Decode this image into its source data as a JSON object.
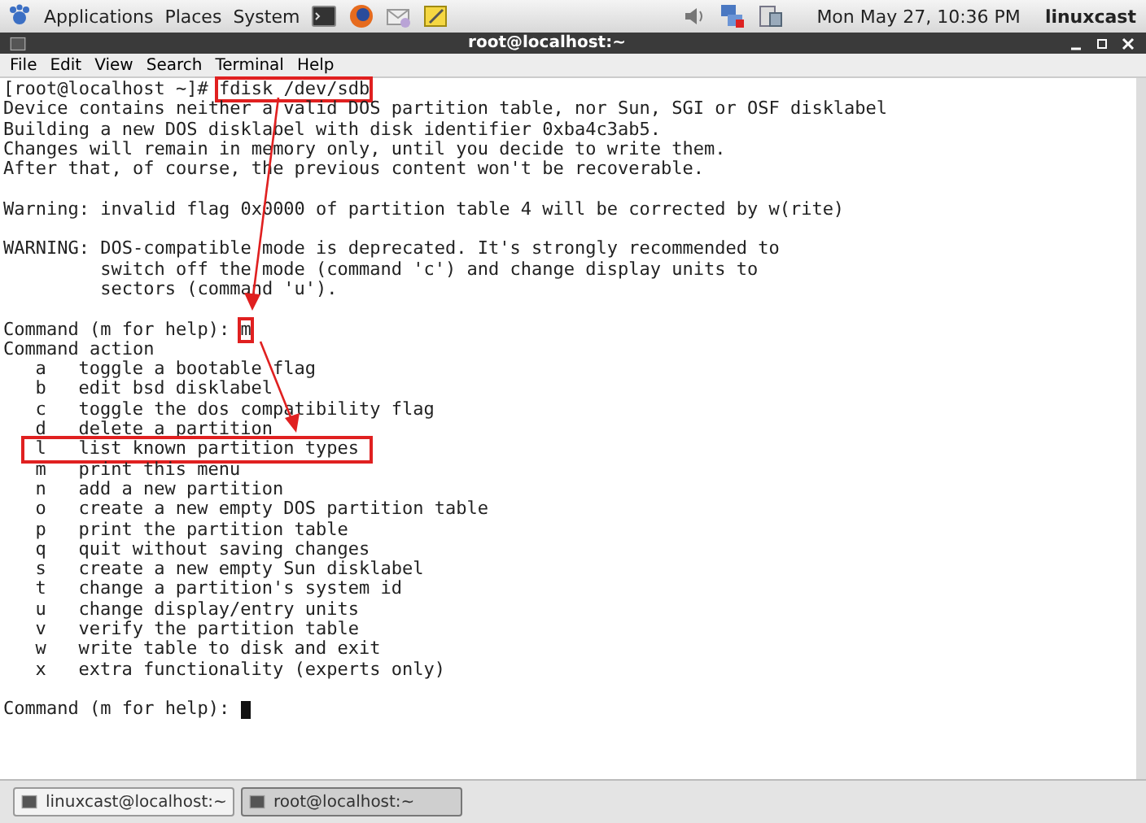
{
  "top_panel": {
    "menus": [
      "Applications",
      "Places",
      "System"
    ],
    "clock": "Mon May 27, 10:36 PM",
    "user": "linuxcast"
  },
  "window": {
    "title": "root@localhost:~"
  },
  "menu_bar": [
    "File",
    "Edit",
    "View",
    "Search",
    "Terminal",
    "Help"
  ],
  "terminal": {
    "lines": [
      {
        "kind": "text",
        "segments": [
          {
            "text": "[root@localhost ~]# ",
            "boxed": false
          },
          {
            "text": "fdisk /dev/sdb",
            "boxed": true
          }
        ]
      },
      {
        "kind": "text",
        "segments": [
          {
            "text": "Device contains neither a valid DOS partition table, nor Sun, SGI or OSF disklabel",
            "boxed": false
          }
        ]
      },
      {
        "kind": "text",
        "segments": [
          {
            "text": "Building a new DOS disklabel with disk identifier 0xba4c3ab5.",
            "boxed": false
          }
        ]
      },
      {
        "kind": "text",
        "segments": [
          {
            "text": "Changes will remain in memory only, until you decide to write them.",
            "boxed": false
          }
        ]
      },
      {
        "kind": "text",
        "segments": [
          {
            "text": "After that, of course, the previous content won't be recoverable.",
            "boxed": false
          }
        ]
      },
      {
        "kind": "blank"
      },
      {
        "kind": "text",
        "segments": [
          {
            "text": "Warning: invalid flag 0x0000 of partition table 4 will be corrected by w(rite)",
            "boxed": false
          }
        ]
      },
      {
        "kind": "blank"
      },
      {
        "kind": "text",
        "segments": [
          {
            "text": "WARNING: DOS-compatible mode is deprecated. It's strongly recommended to",
            "boxed": false
          }
        ]
      },
      {
        "kind": "text",
        "segments": [
          {
            "text": "         switch off the mode (command 'c') and change display units to",
            "boxed": false
          }
        ]
      },
      {
        "kind": "text",
        "segments": [
          {
            "text": "         sectors (command 'u').",
            "boxed": false
          }
        ]
      },
      {
        "kind": "blank"
      },
      {
        "kind": "text",
        "segments": [
          {
            "text": "Command (m for help): ",
            "boxed": false
          },
          {
            "text": "m",
            "boxed": true
          }
        ]
      },
      {
        "kind": "text",
        "segments": [
          {
            "text": "Command action",
            "boxed": false
          }
        ]
      },
      {
        "kind": "menu",
        "segments": [
          {
            "text": "a   toggle a bootable flag",
            "boxed": false
          }
        ]
      },
      {
        "kind": "menu",
        "segments": [
          {
            "text": "b   edit bsd disklabel",
            "boxed": false
          }
        ]
      },
      {
        "kind": "menu",
        "segments": [
          {
            "text": "c   toggle the dos compatibility flag",
            "boxed": false
          }
        ]
      },
      {
        "kind": "menu",
        "segments": [
          {
            "text": "d   delete a partition",
            "boxed": false
          }
        ]
      },
      {
        "kind": "menu",
        "segments": [
          {
            "text": "l   list known partition types",
            "boxed": true
          }
        ]
      },
      {
        "kind": "menu",
        "segments": [
          {
            "text": "m   print this menu",
            "boxed": false
          }
        ]
      },
      {
        "kind": "menu",
        "segments": [
          {
            "text": "n   add a new partition",
            "boxed": false
          }
        ]
      },
      {
        "kind": "menu",
        "segments": [
          {
            "text": "o   create a new empty DOS partition table",
            "boxed": false
          }
        ]
      },
      {
        "kind": "menu",
        "segments": [
          {
            "text": "p   print the partition table",
            "boxed": false
          }
        ]
      },
      {
        "kind": "menu",
        "segments": [
          {
            "text": "q   quit without saving changes",
            "boxed": false
          }
        ]
      },
      {
        "kind": "menu",
        "segments": [
          {
            "text": "s   create a new empty Sun disklabel",
            "boxed": false
          }
        ]
      },
      {
        "kind": "menu",
        "segments": [
          {
            "text": "t   change a partition's system id",
            "boxed": false
          }
        ]
      },
      {
        "kind": "menu",
        "segments": [
          {
            "text": "u   change display/entry units",
            "boxed": false
          }
        ]
      },
      {
        "kind": "menu",
        "segments": [
          {
            "text": "v   verify the partition table",
            "boxed": false
          }
        ]
      },
      {
        "kind": "menu",
        "segments": [
          {
            "text": "w   write table to disk and exit",
            "boxed": false
          }
        ]
      },
      {
        "kind": "menu",
        "segments": [
          {
            "text": "x   extra functionality (experts only)",
            "boxed": false
          }
        ]
      },
      {
        "kind": "blank"
      },
      {
        "kind": "text",
        "segments": [
          {
            "text": "Command (m for help): ",
            "boxed": false
          }
        ],
        "cursor": true
      }
    ]
  },
  "taskbar": [
    {
      "label": "linuxcast@localhost:~",
      "selected": false
    },
    {
      "label": "root@localhost:~",
      "selected": true
    }
  ]
}
